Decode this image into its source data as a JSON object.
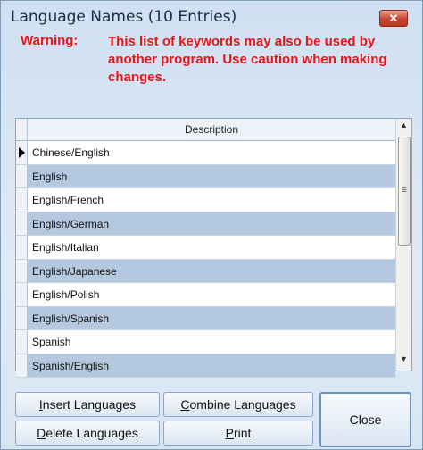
{
  "window": {
    "title": "Language Names (10 Entries)"
  },
  "warning": {
    "label": "Warning:",
    "message": "This list of keywords may also be used by another program. Use caution when making changes."
  },
  "grid": {
    "column_header": "Description",
    "rows": [
      "Chinese/English",
      "English",
      "English/French",
      "English/German",
      "English/Italian",
      "English/Japanese",
      "English/Polish",
      "English/Spanish",
      "Spanish",
      "Spanish/English"
    ],
    "current_row": 0
  },
  "buttons": {
    "insert": {
      "mnemonic": "I",
      "rest": "nsert Languages"
    },
    "combine": {
      "mnemonic": "C",
      "rest": "ombine Languages"
    },
    "delete": {
      "mnemonic": "D",
      "rest": "elete Languages"
    },
    "print": {
      "mnemonic": "P",
      "rest": "rint"
    },
    "close": "Close"
  },
  "icons": {
    "close": "close-icon",
    "row_pointer": "current-row-pointer-icon",
    "scroll_up": "scroll-up-arrow-icon",
    "scroll_down": "scroll-down-arrow-icon"
  },
  "colors": {
    "warning": "#e8151b",
    "close_x": "#c9452f",
    "alt_row": "#b4c9df"
  }
}
